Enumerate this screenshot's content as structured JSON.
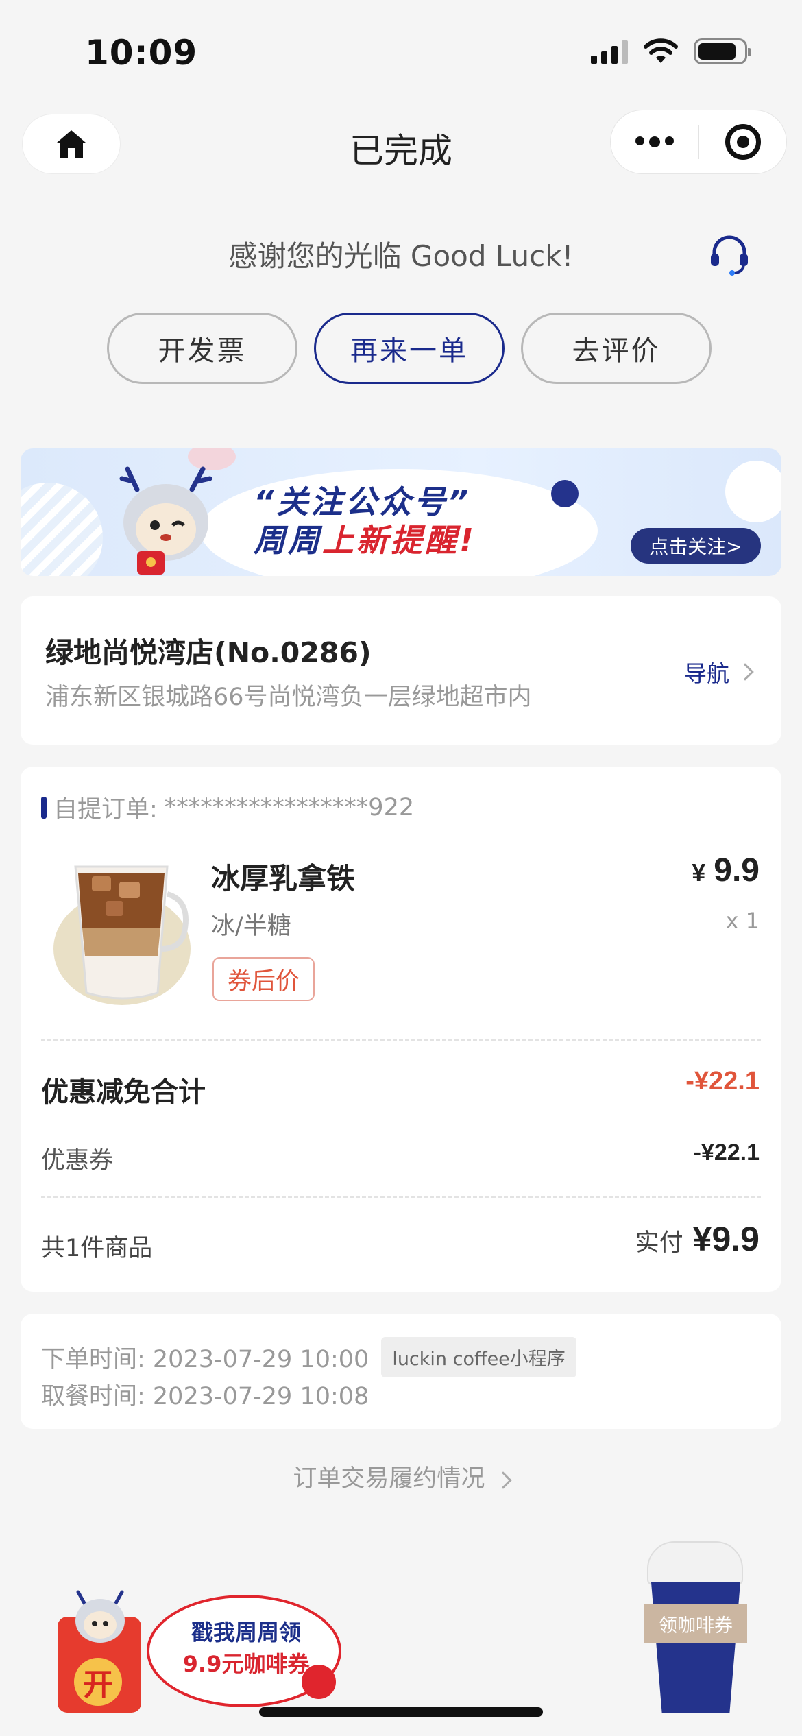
{
  "status_bar": {
    "time": "10:09"
  },
  "nav": {
    "title": "已完成"
  },
  "thanks": {
    "text": "感谢您的光临 Good Luck!"
  },
  "actions": {
    "invoice": "开发票",
    "reorder": "再来一单",
    "review": "去评价"
  },
  "banner": {
    "line1": "“关注公众号”",
    "line2_a": "周周",
    "line2_b": "上新",
    "line2_c": "提醒!",
    "follow": "点击关注>"
  },
  "store": {
    "name": "绿地尚悦湾店(No.0286)",
    "address": "浦东新区银城路66号尚悦湾负一层绿地超市内",
    "navigate": "导航"
  },
  "order": {
    "label": "自提订单:",
    "number": "*****************922",
    "item": {
      "name": "冰厚乳拿铁",
      "spec": "冰/半糖",
      "tag": "券后价",
      "price_symbol": "¥",
      "price": "9.9",
      "qty": "x 1"
    },
    "discount_label": "优惠减免合计",
    "discount_value": "-¥22.1",
    "coupon_label": "优惠券",
    "coupon_value": "-¥22.1",
    "total_label": "共1件商品",
    "paid_label": "实付",
    "paid_value": "¥9.9"
  },
  "times": {
    "order_time": "下单时间:  2023-07-29 10:00",
    "source": "luckin coffee小程序",
    "pickup_time": "取餐时间:  2023-07-29 10:08"
  },
  "trace": {
    "text": "订单交易履约情况"
  },
  "promo": {
    "line1": "戳我周周领",
    "line2": "9.9元咖啡券",
    "envelope_char": "开",
    "cup_label": "领咖啡券"
  },
  "colors": {
    "brand": "#1a2a8c",
    "accent_red": "#e0553b",
    "background": "#f5f5f5"
  }
}
